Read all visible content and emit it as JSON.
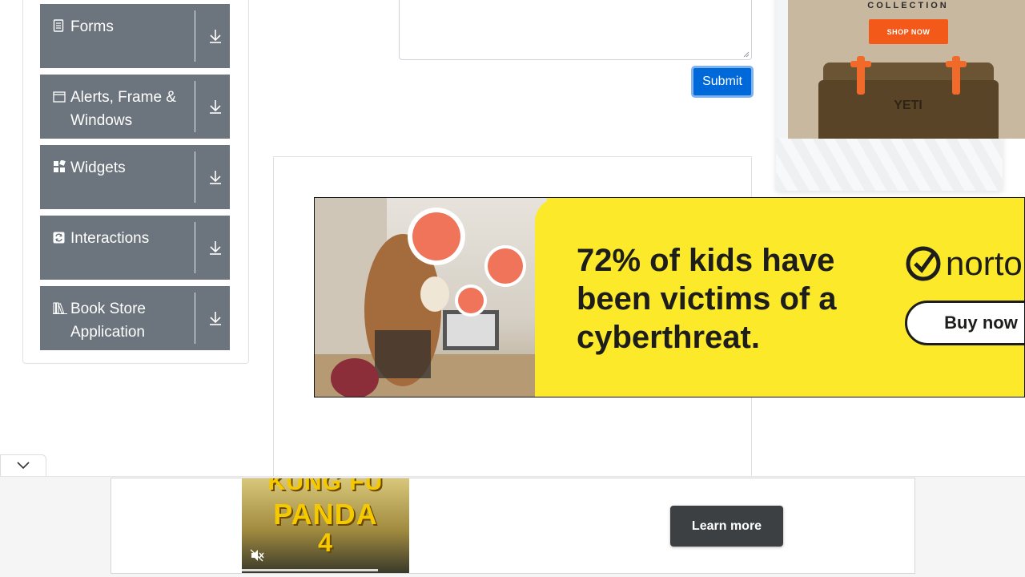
{
  "sidebar": {
    "groups": [
      {
        "label": "Forms",
        "icon": "document-icon"
      },
      {
        "label": "Alerts, Frame & Windows",
        "icon": "window-icon"
      },
      {
        "label": "Widgets",
        "icon": "widgets-icon"
      },
      {
        "label": "Interactions",
        "icon": "interactions-icon"
      },
      {
        "label": "Book Store Application",
        "icon": "books-icon"
      }
    ]
  },
  "form": {
    "submit_label": "Submit"
  },
  "ads": {
    "yeti": {
      "collection_text": "COLLECTION",
      "shop_label": "SHOP NOW",
      "logo_text": "YETI"
    },
    "norton": {
      "headline": "72% of kids have been victims of a cyberthreat.",
      "brand": "norto",
      "buy_label": "Buy now",
      "accent": "#fce92a"
    },
    "bottom": {
      "video_title_1": "KUNG FU",
      "video_title_2": "PANDA",
      "video_title_3": "4",
      "learn_label": "Learn more"
    }
  },
  "colors": {
    "sidebar_group_bg": "#6c757d",
    "submit_bg": "#0069d9",
    "learn_bg": "#3c4043",
    "shop_bg": "#f35a1a"
  }
}
